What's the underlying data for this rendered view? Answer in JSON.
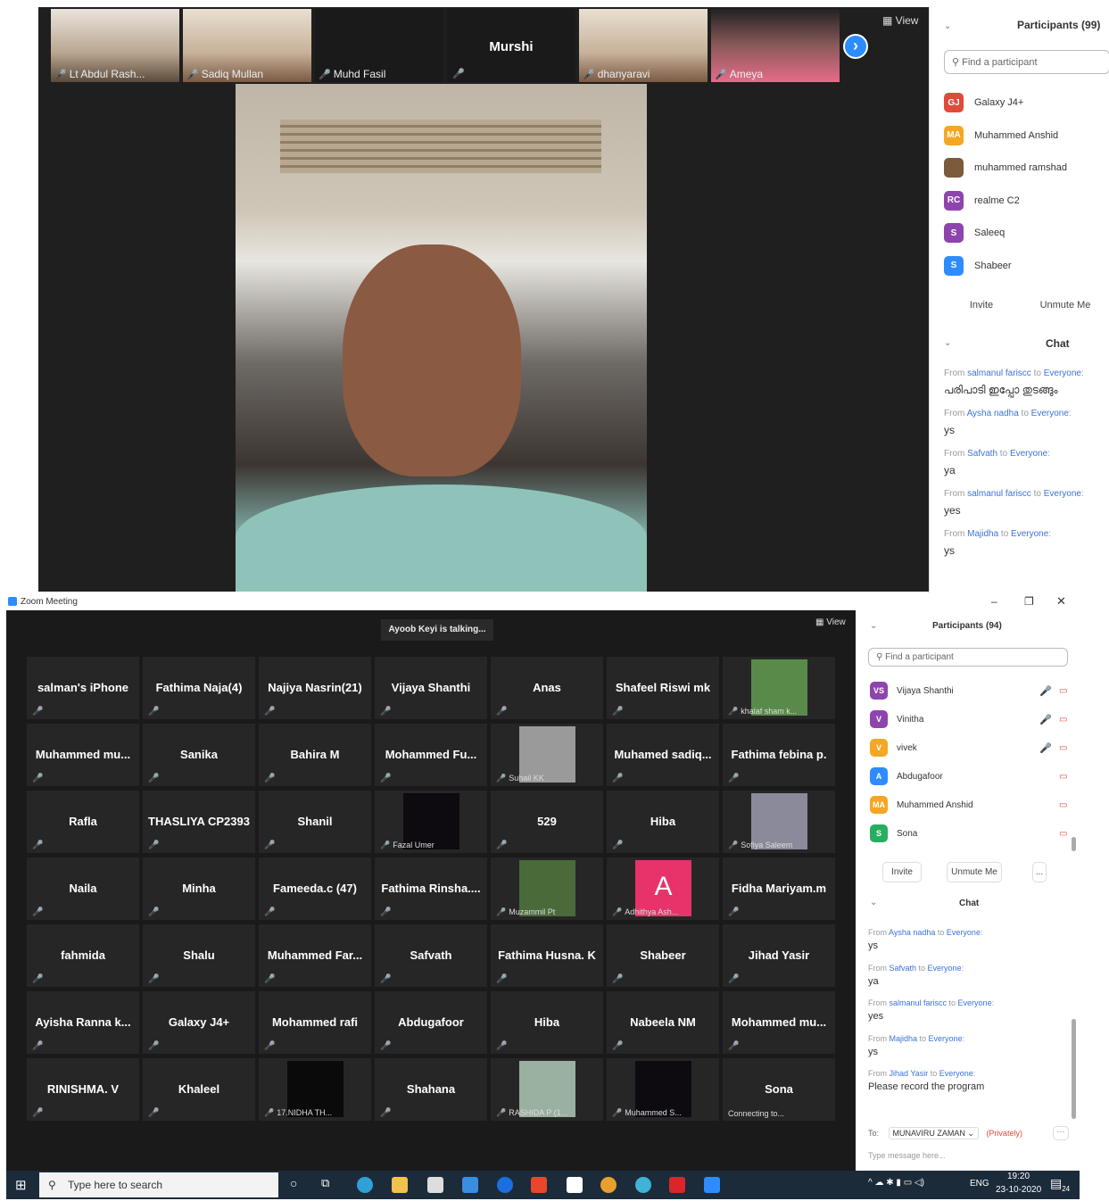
{
  "shot1": {
    "view_label": "View",
    "strip": [
      {
        "name": "Lt Abdul Rash...",
        "video": true
      },
      {
        "name": "Sadiq Mullan",
        "video": true
      },
      {
        "name": "Muhd Fasil",
        "video": false
      },
      {
        "name": "Murshi",
        "video": false,
        "center": true
      },
      {
        "name": "dhanyaravi",
        "video": true
      },
      {
        "name": "Ameya",
        "video": true
      }
    ],
    "participants_title": "Participants (99)",
    "search_placeholder": "Find a participant",
    "participants": [
      {
        "initials": "GJ",
        "name": "Galaxy J4+",
        "color": "#e04a3a"
      },
      {
        "initials": "MA",
        "name": "Muhammed Anshid",
        "color": "#f5a623"
      },
      {
        "initials": "",
        "name": "muhammed ramshad",
        "color": "#7c5a3c"
      },
      {
        "initials": "RC",
        "name": "realme C2",
        "color": "#8e44ad"
      },
      {
        "initials": "S",
        "name": "Saleeq",
        "color": "#8e44ad"
      },
      {
        "initials": "S",
        "name": "Shabeer",
        "color": "#2d8cff"
      }
    ],
    "invite": "Invite",
    "unmute_me": "Unmute Me",
    "chat_title": "Chat",
    "chat": [
      {
        "from": "salmanul fariscc",
        "to": "Everyone",
        "text": "പരിപാടി ഇപ്പോ തുടങ്ങും"
      },
      {
        "from": "Aysha nadha",
        "to": "Everyone",
        "text": "ys"
      },
      {
        "from": "Safvath",
        "to": "Everyone",
        "text": "ya"
      },
      {
        "from": "salmanul fariscc",
        "to": "Everyone",
        "text": "yes"
      },
      {
        "from": "Majidha",
        "to": "Everyone",
        "text": "ys"
      }
    ]
  },
  "shot2": {
    "window_title": "Zoom Meeting",
    "talking": "Ayoob Keyi is talking...",
    "view_label": "View",
    "tiles": [
      {
        "name": "salman's iPhone"
      },
      {
        "name": "Fathima Naja(4)"
      },
      {
        "name": "Najiya Nasrin(21)"
      },
      {
        "name": "Vijaya Shanthi"
      },
      {
        "name": "Anas"
      },
      {
        "name": "Shafeel Riswi mk"
      },
      {
        "name": "khalaf sham k...",
        "photo": "#5a8a4a"
      },
      {
        "name": "Muhammed mu..."
      },
      {
        "name": "Sanika"
      },
      {
        "name": "Bahira M"
      },
      {
        "name": "Mohammed Fu..."
      },
      {
        "name": "Suhail KK",
        "photo": "#9a9a9a"
      },
      {
        "name": "Muhamed sadiq..."
      },
      {
        "name": "Fathima febina p."
      },
      {
        "name": "Rafla"
      },
      {
        "name": "THASLIYA CP2393"
      },
      {
        "name": "Shanil"
      },
      {
        "name": "Fazal Umer",
        "photo": "#0d0b10"
      },
      {
        "name": "529"
      },
      {
        "name": "Hiba"
      },
      {
        "name": "Sofiya Saleem",
        "photo": "#8a8a9a"
      },
      {
        "name": "Naila"
      },
      {
        "name": "Minha"
      },
      {
        "name": "Fameeda.c (47)"
      },
      {
        "name": "Fathima Rinsha...."
      },
      {
        "name": "Muzammil Pt",
        "photo": "#4a6a3a"
      },
      {
        "name": "Adhithya Ash...",
        "photo": "#e8336a",
        "letter": "A"
      },
      {
        "name": "Fidha Mariyam.m"
      },
      {
        "name": "fahmida"
      },
      {
        "name": "Shalu"
      },
      {
        "name": "Muhammed Far..."
      },
      {
        "name": "Safvath"
      },
      {
        "name": "Fathima Husna. K"
      },
      {
        "name": "Shabeer"
      },
      {
        "name": "Jihad Yasir"
      },
      {
        "name": "Ayisha Ranna k..."
      },
      {
        "name": "Galaxy J4+"
      },
      {
        "name": "Mohammed rafi"
      },
      {
        "name": "Abdugafoor"
      },
      {
        "name": "Hiba"
      },
      {
        "name": "Nabeela NM"
      },
      {
        "name": "Mohammed mu..."
      },
      {
        "name": "RINISHMA. V"
      },
      {
        "name": "Khaleel"
      },
      {
        "name": "17.NIDHA TH...",
        "photo": "#0a0a0a"
      },
      {
        "name": "Shahana"
      },
      {
        "name": "RASHIDA P (1...",
        "photo": "#9ab0a0"
      },
      {
        "name": "Muhammed S...",
        "photo": "#0d0b10"
      },
      {
        "name": "Sona",
        "status": "Connecting to..."
      }
    ],
    "participants_title": "Participants (94)",
    "search_placeholder": "Find a participant",
    "participants": [
      {
        "initials": "VS",
        "name": "Vijaya Shanthi",
        "color": "#8e44ad"
      },
      {
        "initials": "V",
        "name": "Vinitha",
        "color": "#8e44ad"
      },
      {
        "initials": "V",
        "name": "vivek",
        "color": "#f5a623"
      },
      {
        "initials": "A",
        "name": "Abdugafoor",
        "color": "#2d8cff"
      },
      {
        "initials": "MA",
        "name": "Muhammed Anshid",
        "color": "#f5a623"
      },
      {
        "initials": "S",
        "name": "Sona",
        "color": "#27ae60"
      }
    ],
    "invite": "Invite",
    "unmute_me": "Unmute Me",
    "more": "...",
    "chat_title": "Chat",
    "chat": [
      {
        "from": "Aysha nadha",
        "to": "Everyone",
        "text": "ys"
      },
      {
        "from": "Safvath",
        "to": "Everyone",
        "text": "ya"
      },
      {
        "from": "salmanul fariscc",
        "to": "Everyone",
        "text": "yes"
      },
      {
        "from": "Majidha",
        "to": "Everyone",
        "text": "ys"
      },
      {
        "from": "Jihad Yasir",
        "to": "Everyone",
        "text": "Please record the program"
      }
    ],
    "to_label": "To:",
    "to_value": "MUNAVIRU ZAMAN",
    "privately": "(Privately)",
    "message_placeholder": "Type message here...",
    "taskbar": {
      "search": "Type here to search",
      "lang": "ENG",
      "time": "19:20",
      "date": "23-10-2020",
      "badge": "24"
    }
  }
}
